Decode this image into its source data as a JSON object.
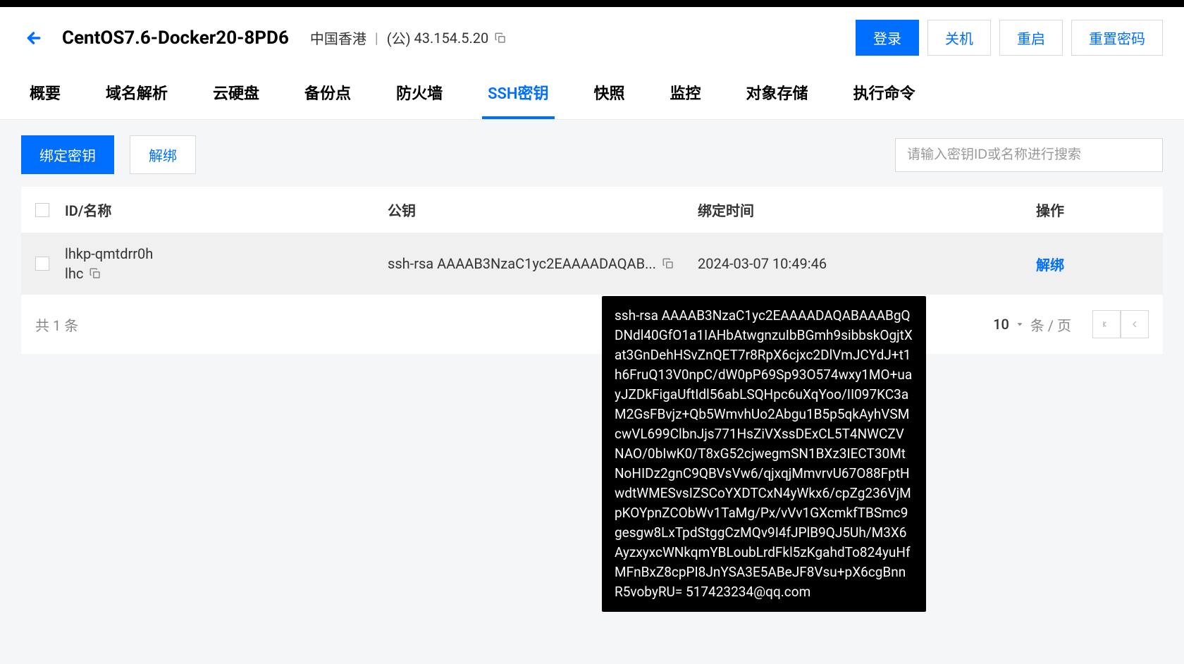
{
  "header": {
    "instance_name": "CentOS7.6-Docker20-8PD6",
    "region": "中国香港",
    "ip_label": "(公)",
    "ip_value": "43.154.5.20",
    "actions": {
      "login": "登录",
      "shutdown": "关机",
      "restart": "重启",
      "reset_password": "重置密码"
    }
  },
  "tabs": {
    "overview": "概要",
    "dns": "域名解析",
    "disk": "云硬盘",
    "backup": "备份点",
    "firewall": "防火墙",
    "ssh_key": "SSH密钥",
    "snapshot": "快照",
    "monitor": "监控",
    "object_storage": "对象存储",
    "execute_cmd": "执行命令"
  },
  "toolbar": {
    "bind_key": "绑定密钥",
    "unbind": "解绑",
    "search_placeholder": "请输入密钥ID或名称进行搜索"
  },
  "table": {
    "headers": {
      "id_name": "ID/名称",
      "public_key": "公钥",
      "bind_time": "绑定时间",
      "action": "操作"
    },
    "rows": [
      {
        "id": "lhkp-qmtdrr0h",
        "name": "lhc",
        "public_key_short": "ssh-rsa AAAAB3NzaC1yc2EAAAADAQAB...",
        "bind_time": "2024-03-07 10:49:46",
        "action": "解绑"
      }
    ]
  },
  "footer": {
    "total_prefix": "共",
    "total_count": "1",
    "total_suffix": "条",
    "page_size": "10",
    "page_size_suffix": "条 / 页"
  },
  "tooltip": {
    "content": "ssh-rsa AAAAB3NzaC1yc2EAAAADAQABAAABgQDNdl40GfO1a1IAHbAtwgnzuIbBGmh9sibbskOgjtXat3GnDehHSvZnQET7r8RpX6cjxc2DlVmJCYdJ+t1h6FruQ13V0npC/dW0pP69Sp93O574wxy1MO+uayJZDkFigaUftIdl56abLSQHpc6uXqYoo/II097KC3aM2GsFBvjz+Qb5WmvhUo2Abgu1B5p5qkAyhVSMcwVL699ClbnJjs771HsZiVXssDExCL5T4NWCZVNAO/0bIwK0/T8xG52cjwegmSN1BXz3IECT30MtNoHIDz2gnC9QBVsVw6/qjxqjMmvrvU67O88FptHwdtWMESvsIZSCoYXDTCxN4yWkx6/cpZg236VjMpKOYpnZCObWv1TaMg/Px/vVv1GXcmkfTBSmc9gesgw8LxTpdStggCzMQv9I4fJPlB9QJ5Uh/M3X6AyzxyxcWNkqmYBLoubLrdFkl5zKgahdTo824yuHfMFnBxZ8cpPI8JnYSA3E5ABeJF8Vsu+pX6cgBnnR5vobyRU= 517423234@qq.com"
  }
}
